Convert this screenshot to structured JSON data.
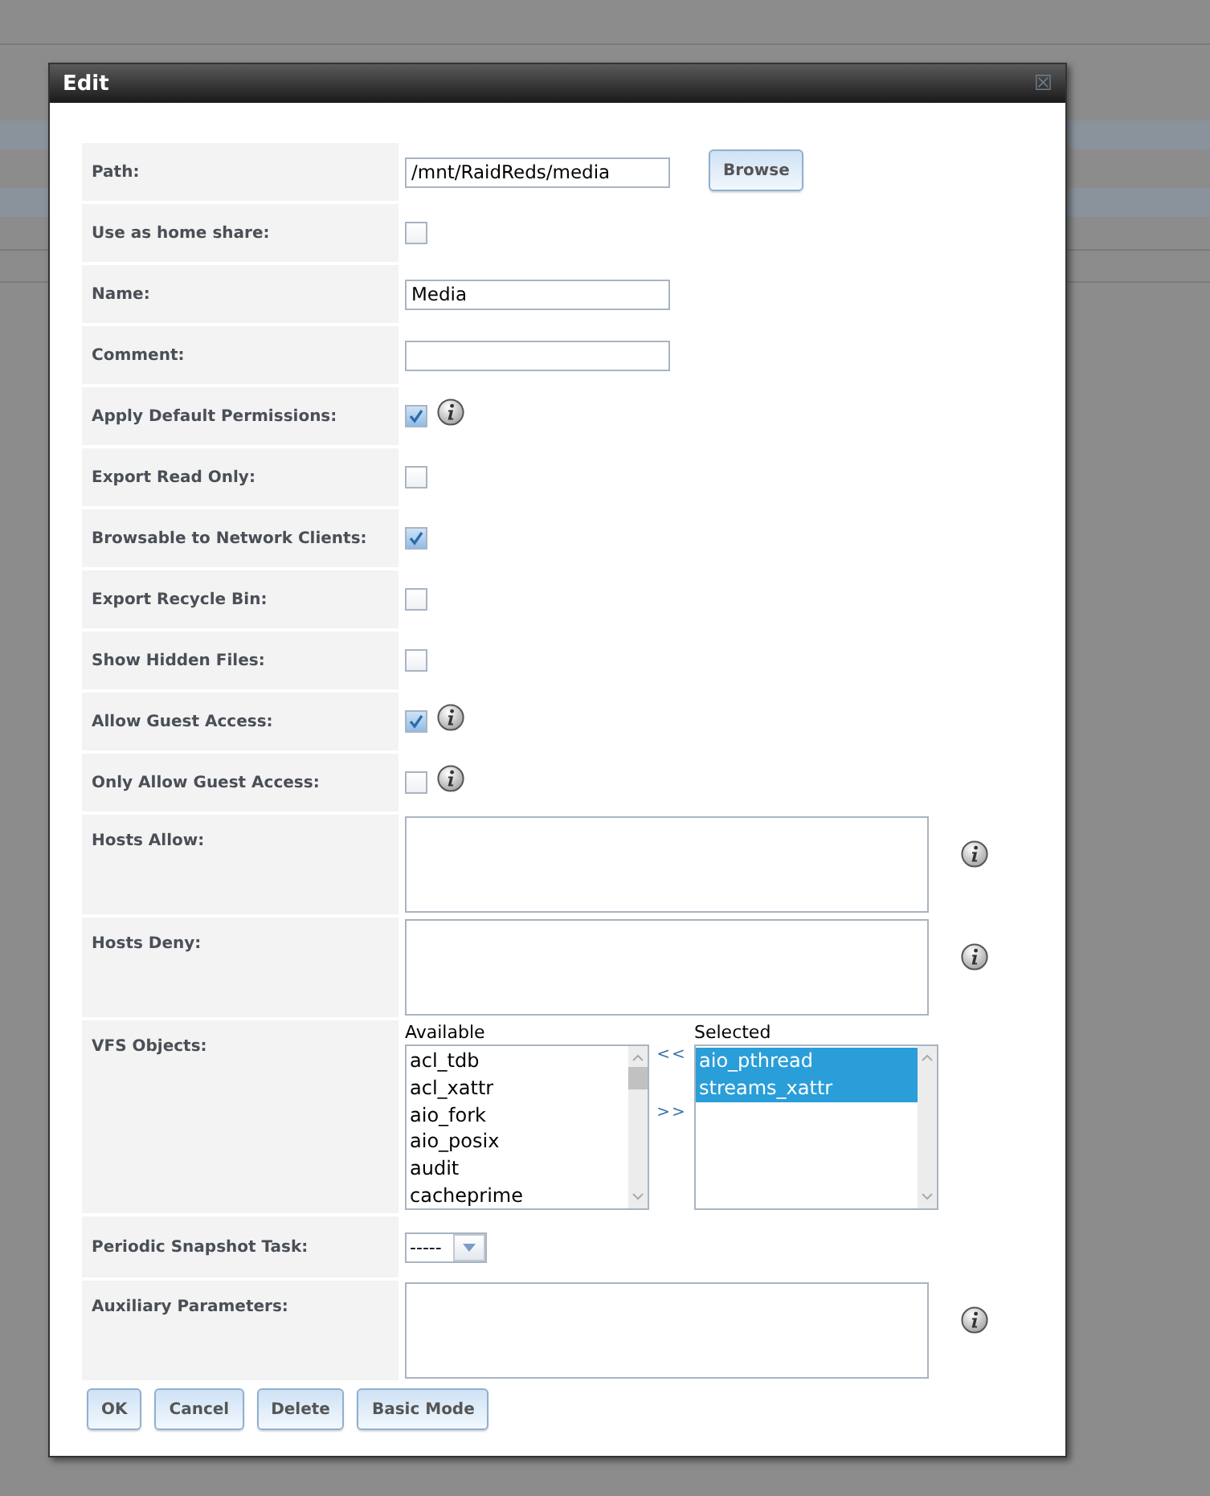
{
  "window": {
    "title": "Edit",
    "close": "☒"
  },
  "fields": [
    {
      "kind": "text",
      "label": "Path:",
      "value": "/mnt/RaidReds/media",
      "button": "Browse",
      "info": false
    },
    {
      "kind": "checkbox",
      "label": "Use as home share:",
      "checked": false,
      "info": false
    },
    {
      "kind": "text",
      "label": "Name:",
      "value": "Media",
      "info": false
    },
    {
      "kind": "text",
      "label": "Comment:",
      "info": false
    },
    {
      "kind": "checkbox",
      "label": "Apply Default Permissions:",
      "checked": true,
      "info": true
    },
    {
      "kind": "checkbox",
      "label": "Export Read Only:",
      "checked": false,
      "info": false
    },
    {
      "kind": "checkbox",
      "label": "Browsable to Network Clients:",
      "checked": true,
      "info": false
    },
    {
      "kind": "checkbox",
      "label": "Export Recycle Bin:",
      "checked": false,
      "info": false
    },
    {
      "kind": "checkbox",
      "label": "Show Hidden Files:",
      "checked": false,
      "info": false
    },
    {
      "kind": "checkbox",
      "label": "Allow Guest Access:",
      "checked": true,
      "info": true
    },
    {
      "kind": "checkbox",
      "label": "Only Allow Guest Access:",
      "checked": false,
      "info": true
    },
    {
      "kind": "textarea",
      "label": "Hosts Allow:",
      "info": true
    },
    {
      "kind": "textarea",
      "label": "Hosts Deny:",
      "info": true
    },
    {
      "kind": "vfs",
      "label": "VFS Objects:",
      "available_label": "Available",
      "available": [
        {
          "text": "acl_tdb",
          "selected": false
        },
        {
          "text": "acl_xattr",
          "selected": false
        },
        {
          "text": "aio_fork",
          "selected": false
        },
        {
          "text": "aio_posix",
          "selected": false
        },
        {
          "text": "audit",
          "selected": false
        },
        {
          "text": "cacheprime",
          "selected": false
        }
      ],
      "remove": "<<",
      "add": ">>",
      "selected_label": "Selected",
      "chosen": [
        {
          "text": "aio_pthread",
          "selected": true
        },
        {
          "text": "streams_xattr",
          "selected": true
        }
      ],
      "info": false
    },
    {
      "kind": "select",
      "label": "Periodic Snapshot Task:",
      "value": "-----",
      "info": false
    },
    {
      "kind": "textarea",
      "label": "Auxiliary Parameters:",
      "info": true
    }
  ],
  "buttons": [
    "OK",
    "Cancel",
    "Delete",
    "Basic Mode"
  ]
}
